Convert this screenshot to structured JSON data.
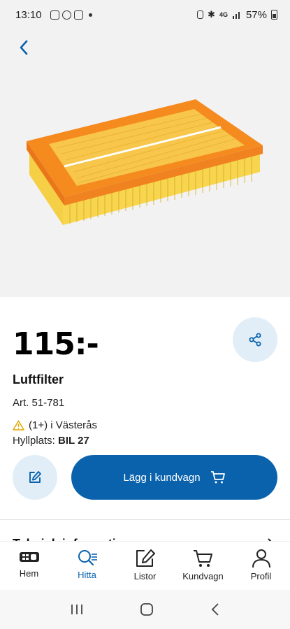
{
  "status_bar": {
    "time": "13:10",
    "battery": "57%",
    "network": "4G"
  },
  "product": {
    "price": "115:-",
    "name": "Luftfilter",
    "article": "Art. 51-781",
    "stock": "(1+) i Västerås",
    "shelf_label": "Hyllplats:",
    "shelf_value": "BIL 27",
    "image_icon": "air-filter-image"
  },
  "actions": {
    "add_to_cart": "Lägg i kundvagn"
  },
  "sections": {
    "technical_info": "Teknisk information"
  },
  "nav": [
    {
      "label": "Hem",
      "icon": "home-logo-icon"
    },
    {
      "label": "Hitta",
      "icon": "search-icon"
    },
    {
      "label": "Listor",
      "icon": "edit-list-icon"
    },
    {
      "label": "Kundvagn",
      "icon": "cart-icon"
    },
    {
      "label": "Profil",
      "icon": "user-icon"
    }
  ],
  "colors": {
    "primary": "#0a62ad",
    "light_accent": "#e1eef8",
    "warning": "#e0a800",
    "filter_orange": "#f58a1f",
    "filter_yellow": "#f7d04a"
  }
}
